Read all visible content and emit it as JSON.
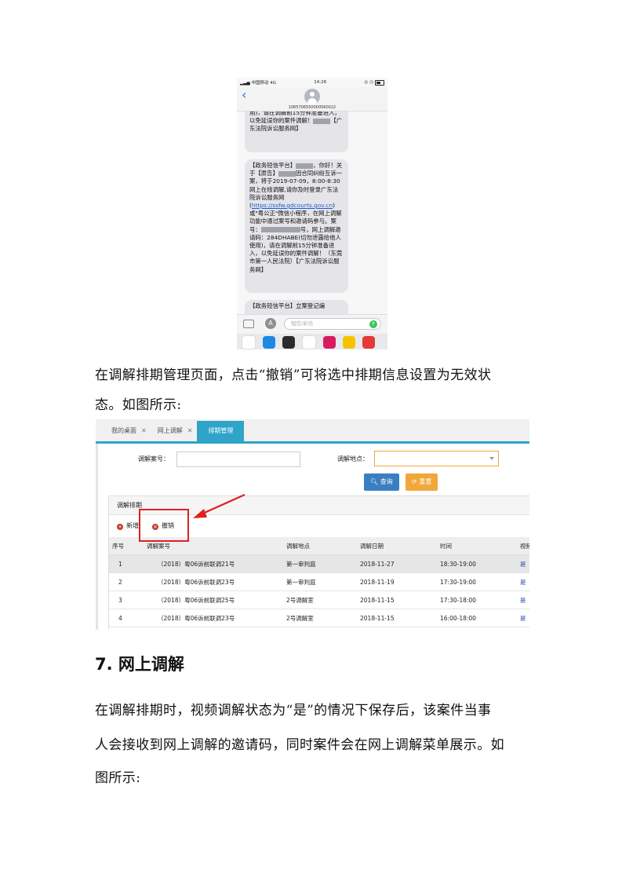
{
  "phone": {
    "carrier": "中国移动",
    "network": "4G",
    "time": "14:26",
    "sender": "10657065500005600​22",
    "messages": {
      "first_tail": "用)，请在调解前15分钟准备进入，以免延误你的案件调解！",
      "first_end": "【广东法院诉讼服务网】",
      "second_p1": "【政务短信平台】",
      "second_p2": "，你好！关于【原告】",
      "second_p3": "因合同纠纷互诉一案，将于2019-07-09，8:00-8:30网上在线调解,请你及时登录广东法院诉讼服务网(",
      "second_link": "https://ssfw.gdcourts.gov.cn",
      "second_p4": ")或\"粤公正\"微信小程序，在网上调解功能中通过案号和邀请码参与。案号：",
      "second_p5": "号，网上调解邀请码：284DHABE(切勿泄露给他人使用)，请在调解前15分钟准备进入，以免延误你的案件调解！（东莞市第一人民法院）【广东法院诉讼服务网】",
      "third": "【政务短信平台】立案登记编"
    },
    "input_placeholder": "短信/彩信"
  },
  "para1": {
    "line1": "在调解排期管理页面，点击“撤销”可将选中排期信息设置为无效状",
    "line2": "态。如图所示:"
  },
  "mgmt": {
    "tabs": [
      {
        "label": "我的桌面"
      },
      {
        "label": "网上调解"
      },
      {
        "label": "排期管理"
      }
    ],
    "form": {
      "case_label": "调解案号：",
      "place_label": "调解地点：",
      "query_label": "查询",
      "reset_label": "重置"
    },
    "panel_title": "调解排期",
    "toolbar": {
      "add_label": "新增",
      "revoke_label": "撤销"
    },
    "columns": [
      "序号",
      "调解案号",
      "调解地点",
      "调解日期",
      "时间",
      "视频"
    ],
    "rows": [
      [
        "1",
        "（2018）粤06诉前联调21号",
        "第一审判庭",
        "2018-11-27",
        "18:30-19:00",
        "是"
      ],
      [
        "2",
        "（2018）粤06诉前联调23号",
        "第一审判庭",
        "2018-11-19",
        "17:30-19:00",
        "是"
      ],
      [
        "3",
        "（2018）粤06诉前联调25号",
        "2号调解室",
        "2018-11-15",
        "17:30-18:00",
        "是"
      ],
      [
        "4",
        "（2018）粤06诉前联调23号",
        "2号调解室",
        "2018-11-15",
        "16:00-18:00",
        "是"
      ]
    ]
  },
  "heading": "7. 网上调解",
  "para2": {
    "line1": "在调解排期时，视频调解状态为“是”的情况下保存后，该案件当事",
    "line2": "人会接收到网上调解的邀请码，同时案件会在网上调解菜单展示。如",
    "line3": "图所示:"
  },
  "colors": {
    "tab_active": "#2fa4c8",
    "query_button": "#3a7fc1",
    "reset_button": "#f0a83a",
    "highlight": "#e02020"
  }
}
